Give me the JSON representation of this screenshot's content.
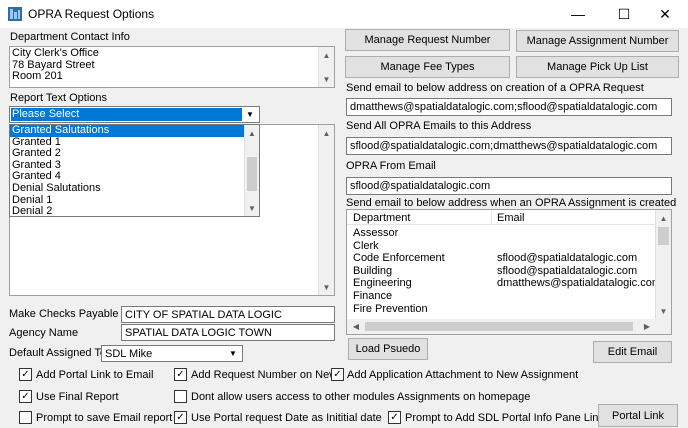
{
  "window": {
    "title": "OPRA Request Options",
    "minimize_glyph": "—",
    "maximize_glyph": "☐",
    "close_glyph": "✕"
  },
  "contact": {
    "label": "Department Contact Info",
    "lines": [
      "City Clerk's Office",
      "78 Bayard Street",
      "Room 201"
    ]
  },
  "report": {
    "label": "Report Text Options",
    "selected": "Please Select",
    "items": [
      "Granted Salutations",
      "Granted 1",
      "Granted 2",
      "Granted 3",
      "Granted 4",
      "Denial Salutations",
      "Denial 1",
      "Denial 2"
    ],
    "selected_index": 0
  },
  "buttons": {
    "manage_request_number": "Manage Request Number",
    "manage_assignment_number": "Manage Assignment Number",
    "manage_fee_types": "Manage Fee Types",
    "manage_pick_up_list": "Manage Pick Up List",
    "load_psuedo": "Load Psuedo",
    "edit_email": "Edit Email",
    "portal_link": "Portal Link"
  },
  "emails": {
    "creation_label": "Send email to below address on creation of a OPRA Request",
    "creation_value": "dmatthews@spatialdatalogic.com;sflood@spatialdatalogic.com",
    "all_label": "Send All OPRA Emails to this Address",
    "all_value": "sflood@spatialdatalogic.com;dmatthews@spatialdatalogic.com",
    "from_label": "OPRA From Email",
    "from_value": "sflood@spatialdatalogic.com",
    "assignment_label": "Send email to below address when an OPRA Assignment is created"
  },
  "grid": {
    "headers": [
      "Department",
      "Email"
    ],
    "rows": [
      {
        "department": "Assessor",
        "email": ""
      },
      {
        "department": "Clerk",
        "email": ""
      },
      {
        "department": "Code Enforcement",
        "email": "sflood@spatialdatalogic.com"
      },
      {
        "department": "Building",
        "email": "sflood@spatialdatalogic.com"
      },
      {
        "department": "Engineering",
        "email": "dmatthews@spatialdatalogic.com"
      },
      {
        "department": "Finance",
        "email": ""
      },
      {
        "department": "Fire Prevention",
        "email": ""
      }
    ]
  },
  "fields": {
    "checks_label": "Make Checks Payable to",
    "checks_value": "CITY OF SPATIAL DATA LOGIC",
    "agency_label": "Agency Name",
    "agency_value": "SPATIAL DATA LOGIC TOWN",
    "assigned_label": "Default Assigned To",
    "assigned_value": "SDL Mike"
  },
  "checkboxes": {
    "add_portal_link": {
      "label": "Add Portal Link to Email",
      "checked": true
    },
    "use_final_report": {
      "label": "Use Final Report",
      "checked": true
    },
    "prompt_save_email": {
      "label": "Prompt to save Email report",
      "checked": false
    },
    "add_request_number": {
      "label": "Add Request Number on New",
      "checked": true
    },
    "dont_allow_access": {
      "label": "Dont allow users access to other modules Assignments on homepage",
      "checked": false
    },
    "use_portal_date": {
      "label": "Use Portal request Date as Inititial date",
      "checked": true
    },
    "add_app_attachment": {
      "label": "Add Application Attachment to New Assignment",
      "checked": true
    },
    "prompt_sdl_portal": {
      "label": "Prompt to Add SDL Portal Info Pane Link",
      "checked": true
    }
  },
  "icons": {
    "check": "✓",
    "up": "▲",
    "down": "▼",
    "left": "◀",
    "right": "▶"
  }
}
